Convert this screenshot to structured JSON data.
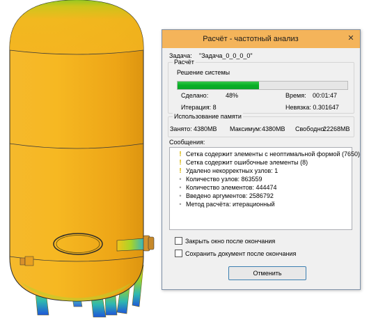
{
  "scene": {
    "object": "pressure-vessel-3d-model"
  },
  "dialog": {
    "title": "Расчёт - частотный анализ",
    "close_label": "✕",
    "task_label": "Задача:",
    "task_value": "\"Задача_0_0_0_0\"",
    "calc_group_title": "Расчёт",
    "solution_label": "Решение системы",
    "progress_fraction": 0.48,
    "done_label": "Сделано:",
    "done_value": "48%",
    "time_label": "Время:",
    "time_value": "00:01:47",
    "iteration_label": "Итерация: 8",
    "residual_label": "Невязка: 0.301647",
    "memory_group_title": "Использование памяти",
    "used_label": "Занято:",
    "used_value": "4380MB",
    "max_label": "Максимум:",
    "max_value": "4380MB",
    "free_label": "Свободно:",
    "free_value": "22268MB",
    "messages_label": "Сообщения:",
    "messages": [
      {
        "icon": "warning-icon",
        "text": "Сетка содержит элементы с неоптимальной формой (7650)"
      },
      {
        "icon": "warning-icon",
        "text": "Сетка содержит ошибочные элементы (8)"
      },
      {
        "icon": "warning-icon",
        "text": "Удалено некорректных узлов: 1"
      },
      {
        "icon": "bullet-icon",
        "text": "Количество узлов: 863559"
      },
      {
        "icon": "bullet-icon",
        "text": "Количество элементов: 444474"
      },
      {
        "icon": "bullet-icon",
        "text": "Введено аргументов: 2586792"
      },
      {
        "icon": "bullet-icon",
        "text": "Метод расчёта: итерационный"
      }
    ],
    "close_when_done_label": "Закрыть окно после окончания",
    "save_when_done_label": "Сохранить документ после окончания",
    "cancel_label": "Отменить"
  },
  "colors": {
    "titlebar": "#f4b45a",
    "progress": "#06b025",
    "vessel": "#f2b01e"
  }
}
